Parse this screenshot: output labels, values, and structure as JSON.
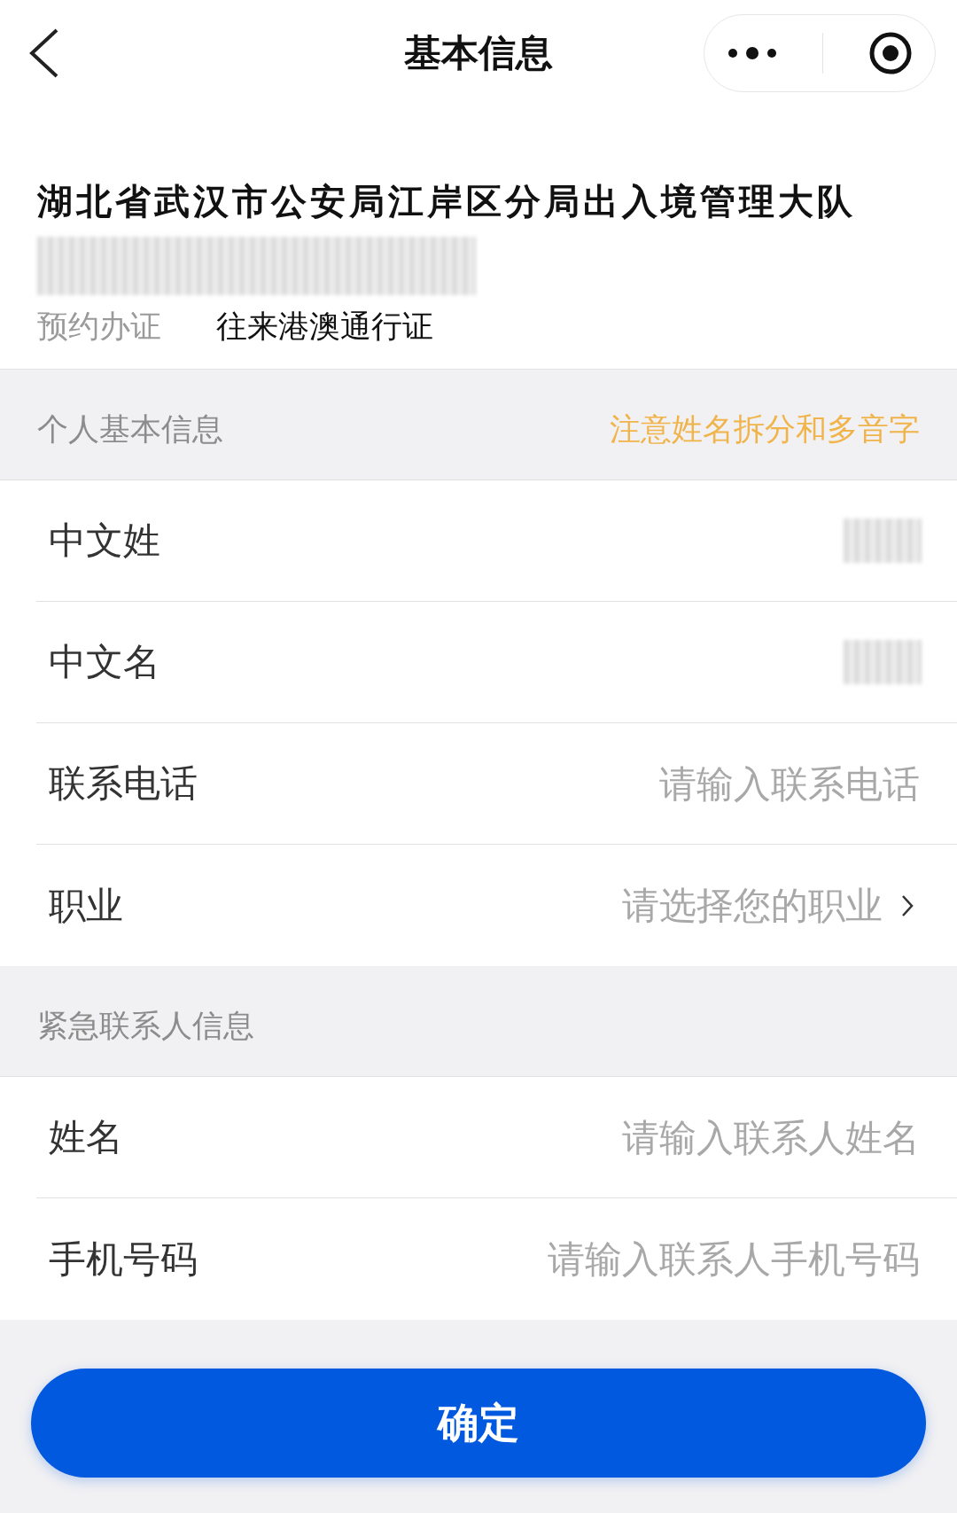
{
  "nav": {
    "title": "基本信息"
  },
  "office": {
    "name": "湖北省武汉市公安局江岸区分局出入境管理大队",
    "address_redacted": true,
    "service_label": "预约办证",
    "service_value": "往来港澳通行证"
  },
  "sections": [
    {
      "title": "个人基本信息",
      "note": "注意姓名拆分和多音字",
      "rows": [
        {
          "label": "中文姓",
          "kind": "redacted"
        },
        {
          "label": "中文名",
          "kind": "redacted"
        },
        {
          "label": "联系电话",
          "kind": "input",
          "placeholder": "请输入联系电话"
        },
        {
          "label": "职业",
          "kind": "select",
          "placeholder": "请选择您的职业"
        }
      ]
    },
    {
      "title": "紧急联系人信息",
      "rows": [
        {
          "label": "姓名",
          "kind": "input",
          "placeholder": "请输入联系人姓名"
        },
        {
          "label": "手机号码",
          "kind": "input",
          "placeholder": "请输入联系人手机号码"
        }
      ]
    }
  ],
  "confirm_button": "确定"
}
